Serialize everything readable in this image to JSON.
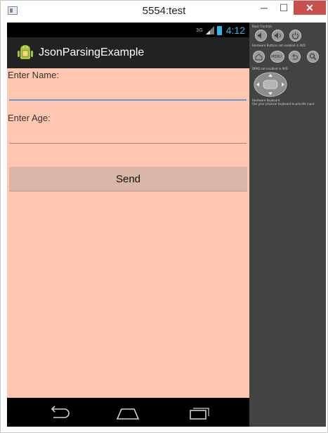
{
  "window": {
    "title": "5554:test",
    "minimize_label": "─",
    "maximize_label": "☐",
    "close_label": "✕"
  },
  "statusbar": {
    "network": "3G",
    "time": "4:12",
    "accent": "#33b5e5"
  },
  "actionbar": {
    "app_title": "JsonParsingExample",
    "icon": "android-icon"
  },
  "form": {
    "name_label": "Enter Name:",
    "name_value": "",
    "age_label": "Enter Age:",
    "age_value": "",
    "send_label": "Send",
    "background": "#ffc7b0"
  },
  "navbar": {
    "icons": [
      "back-icon",
      "home-icon",
      "recent-apps-icon"
    ]
  },
  "control_panel": {
    "basic_controls": "Basic Controls",
    "hardware_buttons": "Hardware Buttons",
    "hardware_buttons_note": "not enabled in AVD",
    "menu_label": "MENU",
    "dpad": "DPAD",
    "dpad_note": "not enabled in AVD",
    "keyboard": "Hardware Keyboard",
    "keyboard_note": "Use your physical keyboard to provide input"
  }
}
